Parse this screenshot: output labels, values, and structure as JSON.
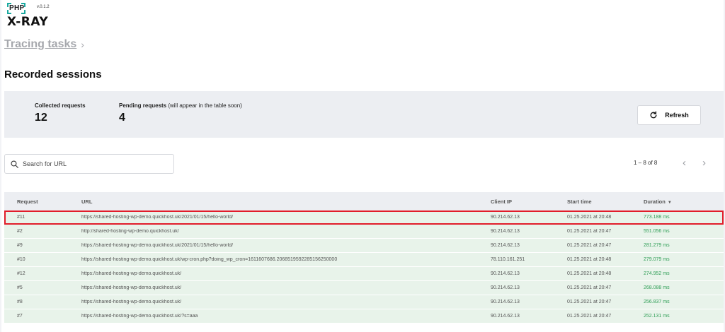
{
  "logo": {
    "php": "PHP",
    "version": "v.0.1.2",
    "name": "X-RAY"
  },
  "breadcrumb": {
    "label": "Tracing tasks",
    "chevron": "›"
  },
  "title": "Recorded sessions",
  "stats": {
    "collected_label": "Collected requests",
    "collected_value": "12",
    "pending_label": "Pending requests",
    "pending_note": "(will appear in the table soon)",
    "pending_value": "4"
  },
  "refresh": {
    "label": "Refresh",
    "icon": "refresh-icon"
  },
  "search": {
    "placeholder": "Search for URL",
    "value": "",
    "icon": "search-icon"
  },
  "pager": {
    "text": "1 – 8 of 8",
    "prev": "‹",
    "next": "›"
  },
  "table": {
    "headers": {
      "request": "Request",
      "url": "URL",
      "client_ip": "Client IP",
      "start_time": "Start time",
      "duration": "Duration",
      "sort_icon": "▼"
    },
    "rows": [
      {
        "request": "#11",
        "url": "https://shared-hosting-wp-demo.quickhost.uk/2021/01/15/hello-world/",
        "client_ip": "90.214.62.13",
        "start_time": "01.25.2021 at 20:48",
        "duration": "773.188 ms"
      },
      {
        "request": "#2",
        "url": "http://shared-hosting-wp-demo.quickhost.uk/",
        "client_ip": "90.214.62.13",
        "start_time": "01.25.2021 at 20:47",
        "duration": "551.056 ms"
      },
      {
        "request": "#9",
        "url": "https://shared-hosting-wp-demo.quickhost.uk/2021/01/15/hello-world/",
        "client_ip": "90.214.62.13",
        "start_time": "01.25.2021 at 20:47",
        "duration": "281.279 ms"
      },
      {
        "request": "#10",
        "url": "https://shared-hosting-wp-demo.quickhost.uk/wp-cron.php?doing_wp_cron=1611607686.2068519592285156250000",
        "client_ip": "78.110.161.251",
        "start_time": "01.25.2021 at 20:48",
        "duration": "279.079 ms"
      },
      {
        "request": "#12",
        "url": "https://shared-hosting-wp-demo.quickhost.uk/",
        "client_ip": "90.214.62.13",
        "start_time": "01.25.2021 at 20:48",
        "duration": "274.952 ms"
      },
      {
        "request": "#5",
        "url": "https://shared-hosting-wp-demo.quickhost.uk/",
        "client_ip": "90.214.62.13",
        "start_time": "01.25.2021 at 20:47",
        "duration": "268.088 ms"
      },
      {
        "request": "#8",
        "url": "https://shared-hosting-wp-demo.quickhost.uk/",
        "client_ip": "90.214.62.13",
        "start_time": "01.25.2021 at 20:47",
        "duration": "256.837 ms"
      },
      {
        "request": "#7",
        "url": "https://shared-hosting-wp-demo.quickhost.uk/?s=aaa",
        "client_ip": "90.214.62.13",
        "start_time": "01.25.2021 at 20:47",
        "duration": "252.131 ms"
      }
    ]
  },
  "colors": {
    "accent": "#1aa9a0",
    "duration": "#2f9e56",
    "selected_outline": "#e11d2a",
    "row_bg": "#e8f3ea"
  }
}
